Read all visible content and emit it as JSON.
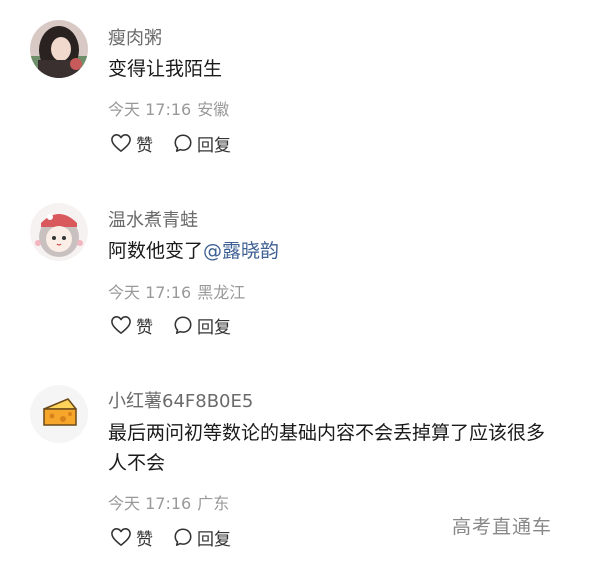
{
  "comments": [
    {
      "username": "瘦肉粥",
      "content_text": "变得让我陌生",
      "mention": "",
      "time": "今天 17:16",
      "location": "安徽",
      "like_label": "赞",
      "reply_label": "回复",
      "avatar_icon": "girl-photo-avatar"
    },
    {
      "username": "温水煮青蛙",
      "content_text": "阿数他变了",
      "mention": "@露晓韵",
      "time": "今天 17:16",
      "location": "黑龙江",
      "like_label": "赞",
      "reply_label": "回复",
      "avatar_icon": "cartoon-girl-avatar"
    },
    {
      "username": "小红薯64F8B0E5",
      "content_text": "最后两问初等数论的基础内容不会丢掉算了应该很多人不会",
      "mention": "",
      "time": "今天 17:16",
      "location": "广东",
      "like_label": "赞",
      "reply_label": "回复",
      "avatar_icon": "cheese-avatar"
    }
  ],
  "watermark": "高考直通车",
  "colors": {
    "username": "#6b6b6b",
    "meta": "#999999",
    "mention": "#3d5f93",
    "text": "#1a1a1a"
  }
}
